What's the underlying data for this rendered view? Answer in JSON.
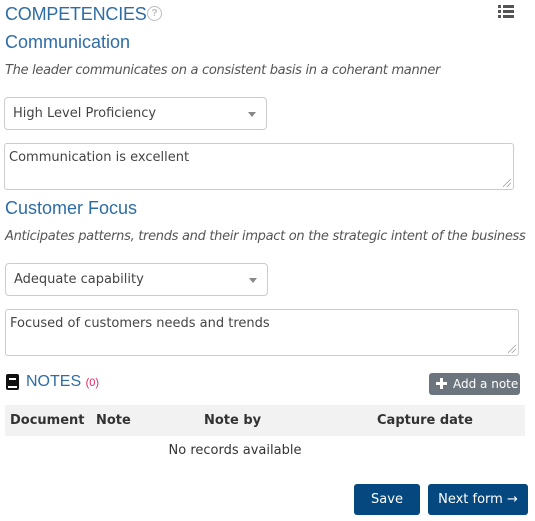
{
  "header": {
    "title": "COMPETENCIES",
    "help_icon": "question-circle-icon",
    "menu_icon": "list-icon"
  },
  "competencies": [
    {
      "name": "Communication",
      "description": "The leader communicates on a consistent basis in a coherant manner",
      "rating": "High Level Proficiency",
      "comment": "Communication is excellent"
    },
    {
      "name": "Customer Focus",
      "description": "Anticipates patterns, trends and their impact on the strategic intent of the business",
      "rating": "Adequate capability",
      "comment": "Focused of customers needs and trends"
    }
  ],
  "notes": {
    "title": "NOTES",
    "count": "(0)",
    "icon": "book-icon",
    "add_button": "Add a note",
    "columns": [
      "Document",
      "Note",
      "Note by",
      "Capture date"
    ],
    "empty_message": "No records available"
  },
  "actions": {
    "save": "Save",
    "next": "Next form →"
  },
  "colors": {
    "heading": "#2e6da4",
    "primary_button": "#05487f",
    "secondary_button": "#6c757d",
    "count": "#e0245e"
  }
}
